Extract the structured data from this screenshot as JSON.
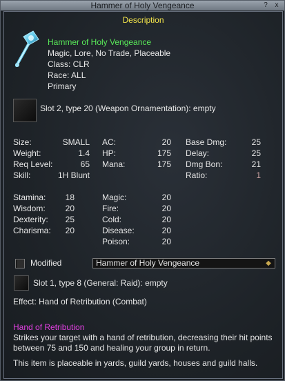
{
  "window": {
    "title": "Hammer of Holy Vengeance",
    "help_label": "?",
    "close_label": "x"
  },
  "header": {
    "label": "Description"
  },
  "item": {
    "name": "Hammer of Holy Vengeance",
    "flags": "Magic, Lore, No Trade, Placeable",
    "class_line": "Class: CLR",
    "race_line": "Race: ALL",
    "slot_line": "Primary",
    "icon": "hammer-icon",
    "ornament_slot": "Slot 2, type 20 (Weapon Ornamentation): empty"
  },
  "stats": {
    "size_label": "Size:",
    "size_value": "SMALL",
    "weight_label": "Weight:",
    "weight_value": "1.4",
    "reqlevel_label": "Req Level:",
    "reqlevel_value": "65",
    "skill_label": "Skill:",
    "skill_value": "1H Blunt",
    "ac_label": "AC:",
    "ac_value": "20",
    "hp_label": "HP:",
    "hp_value": "175",
    "mana_label": "Mana:",
    "mana_value": "175",
    "basedmg_label": "Base Dmg:",
    "basedmg_value": "25",
    "delay_label": "Delay:",
    "delay_value": "25",
    "dmgbon_label": "Dmg Bon:",
    "dmgbon_value": "21",
    "ratio_label": "Ratio:",
    "ratio_value": "1"
  },
  "attributes": {
    "stamina_label": "Stamina:",
    "stamina_value": "18",
    "wisdom_label": "Wisdom:",
    "wisdom_value": "20",
    "dexterity_label": "Dexterity:",
    "dexterity_value": "25",
    "charisma_label": "Charisma:",
    "charisma_value": "20",
    "magic_label": "Magic:",
    "magic_value": "20",
    "fire_label": "Fire:",
    "fire_value": "20",
    "cold_label": "Cold:",
    "cold_value": "20",
    "disease_label": "Disease:",
    "disease_value": "20",
    "poison_label": "Poison:",
    "poison_value": "20"
  },
  "modified": {
    "label": "Modified",
    "checked": false,
    "selected": "Hammer of Holy Vengeance"
  },
  "aug_slot": "Slot 1, type 8 (General: Raid): empty",
  "effect": "Effect: Hand of Retribution (Combat)",
  "spell": {
    "name": "Hand of Retribution",
    "description": "Strikes your target with a hand of retribution, decreasing their hit points between 75 and 150 and healing your group in return."
  },
  "placeable_note": "This item is placeable in yards, guild yards, houses and guild halls.",
  "colors": {
    "name_green": "#58e858",
    "header_yellow": "#f2e34a",
    "spell_magenta": "#e040e0",
    "ratio_red": "#c8a0a0"
  }
}
